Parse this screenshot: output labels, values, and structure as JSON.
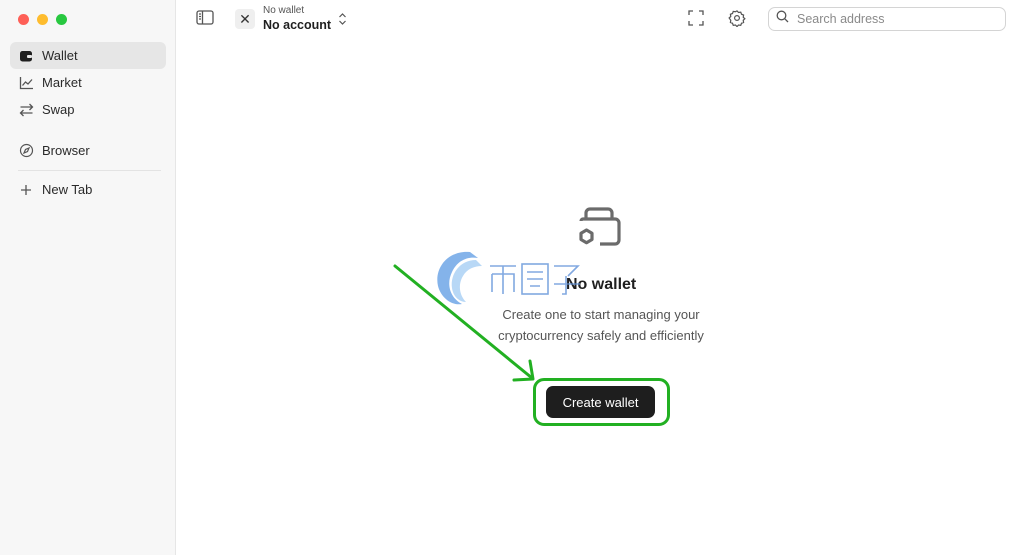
{
  "sidebar": {
    "items": [
      {
        "label": "Wallet",
        "icon": "wallet-icon",
        "active": true
      },
      {
        "label": "Market",
        "icon": "chart-line-icon",
        "active": false
      },
      {
        "label": "Swap",
        "icon": "swap-arrows-icon",
        "active": false
      },
      {
        "label": "Browser",
        "icon": "compass-icon",
        "active": false
      },
      {
        "label": "New Tab",
        "icon": "plus-icon",
        "active": false
      }
    ]
  },
  "topbar": {
    "account_small": "No wallet",
    "account_main": "No account",
    "search_placeholder": "Search address"
  },
  "main": {
    "empty_title": "No wallet",
    "empty_description": "Create one to start managing your cryptocurrency safely and efficiently",
    "create_button": "Create wallet"
  },
  "colors": {
    "sidebar_bg": "#f7f7f7",
    "button_bg": "#1e1e1e",
    "annotation_green": "#22b022"
  }
}
